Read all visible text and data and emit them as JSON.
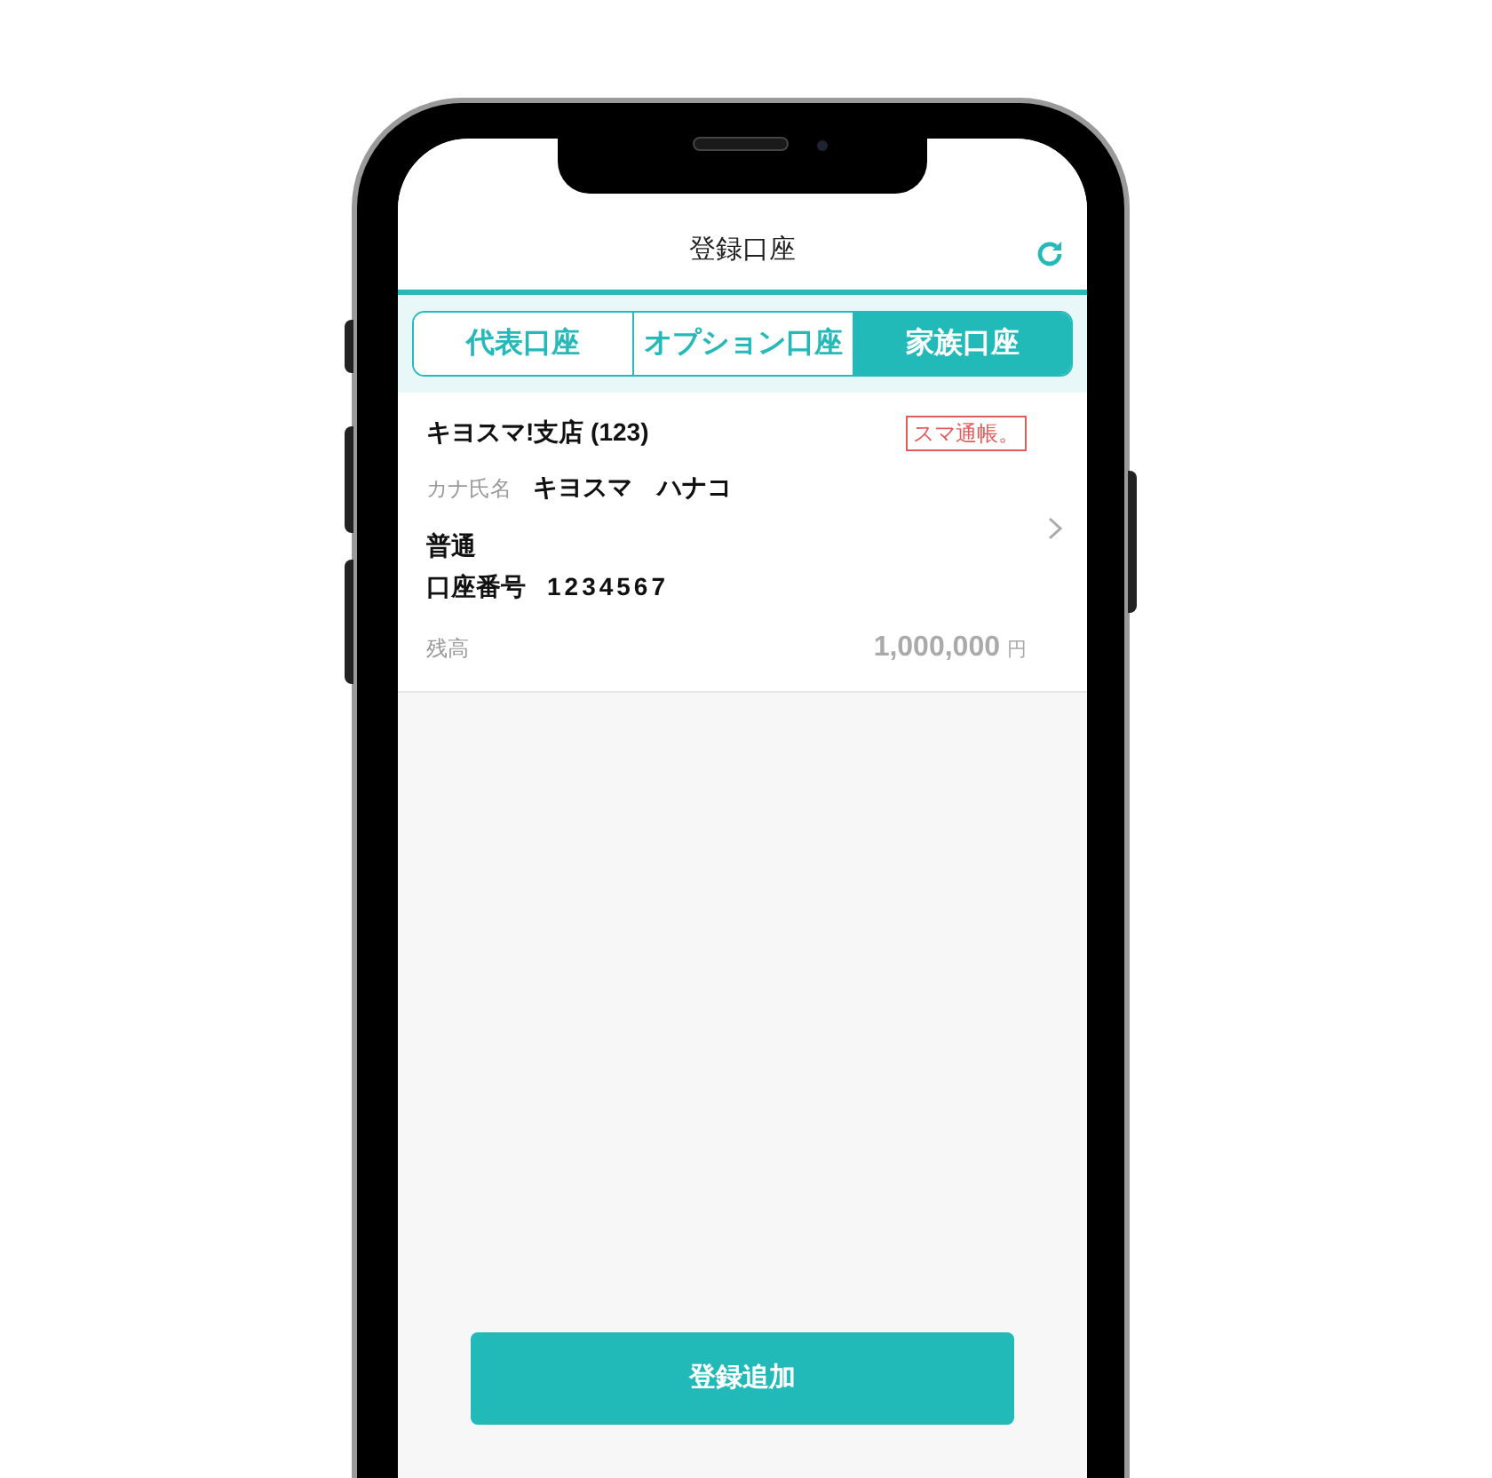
{
  "header": {
    "title": "登録口座"
  },
  "tabs": [
    {
      "label": "代表口座",
      "selected": false
    },
    {
      "label": "オプション口座",
      "selected": false
    },
    {
      "label": "家族口座",
      "selected": true
    }
  ],
  "account": {
    "branch": "キヨスマ!支店 (123)",
    "badge": "スマ通帳。",
    "name_label": "カナ氏名",
    "name": "キヨスマ　ハナコ",
    "type": "普通",
    "number_label": "口座番号",
    "number": "1234567",
    "balance_label": "残高",
    "balance": "1,000,000",
    "currency": "円"
  },
  "add_button": "登録追加"
}
